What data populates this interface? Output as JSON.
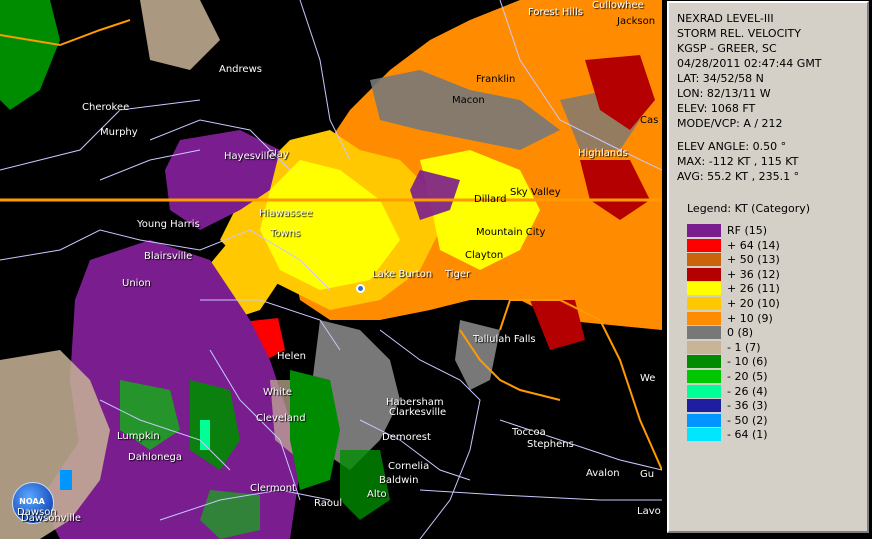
{
  "panel": {
    "product": "NEXRAD LEVEL-III",
    "type": "STORM REL. VELOCITY",
    "station": "KGSP - GREER, SC",
    "datetime": "04/28/2011 02:47:44 GMT",
    "lat": "LAT: 34/52/58 N",
    "lon": "LON: 82/13/11 W",
    "elev": "ELEV: 1068 FT",
    "mode": "MODE/VCP: A / 212",
    "elev_angle": "ELEV ANGLE: 0.50 °",
    "max": "MAX: -112 KT , 115 KT",
    "avg": "AVG: 55.2 KT , 235.1 °",
    "legend_title": "Legend: KT (Category)"
  },
  "legend": [
    {
      "label": "RF  (15)",
      "color": "#7a1d8f"
    },
    {
      "label": "+ 64  (14)",
      "color": "#ff0000"
    },
    {
      "label": "+ 50  (13)",
      "color": "#c8640a"
    },
    {
      "label": "+ 36  (12)",
      "color": "#b40000"
    },
    {
      "label": "+ 26  (11)",
      "color": "#ffff00"
    },
    {
      "label": "+ 20  (10)",
      "color": "#ffc800"
    },
    {
      "label": "+ 10  (9)",
      "color": "#ff8c00"
    },
    {
      "label": "0  (8)",
      "color": "#787878"
    },
    {
      "label": "- 1  (7)",
      "color": "#c8b496"
    },
    {
      "label": "- 10  (6)",
      "color": "#008c00"
    },
    {
      "label": "- 20  (5)",
      "color": "#00c800"
    },
    {
      "label": "- 26  (4)",
      "color": "#00ff96"
    },
    {
      "label": "- 36  (3)",
      "color": "#1e1ea0"
    },
    {
      "label": "- 50  (2)",
      "color": "#0096ff"
    },
    {
      "label": "- 64  (1)",
      "color": "#00e6ff"
    }
  ],
  "cities": [
    "Forest Hills",
    "Cullowhee",
    "Jackson",
    "Andrews",
    "Franklin",
    "Macon",
    "Cherokee",
    "Murphy",
    "Clay",
    "Hayesville",
    "Highlands",
    "Sky Valley",
    "Dillard",
    "Hiawassee",
    "Young Harris",
    "Towns",
    "Mountain City",
    "Clayton",
    "Blairsville",
    "Lake Burton",
    "Tiger",
    "Union",
    "Tallulah Falls",
    "Helen",
    "White",
    "Cleveland",
    "Habersham",
    "Clarkesville",
    "Lumpkin",
    "Dahlonega",
    "Demorest",
    "Toccoa",
    "Stephens",
    "Cornelia",
    "Baldwin",
    "Clermont",
    "Alto",
    "Raoul",
    "Dawson",
    "Dawsonville",
    "Avalon",
    "Cas",
    "We",
    "Gu",
    "Lavo"
  ],
  "logo": {
    "text": "NOAA"
  }
}
